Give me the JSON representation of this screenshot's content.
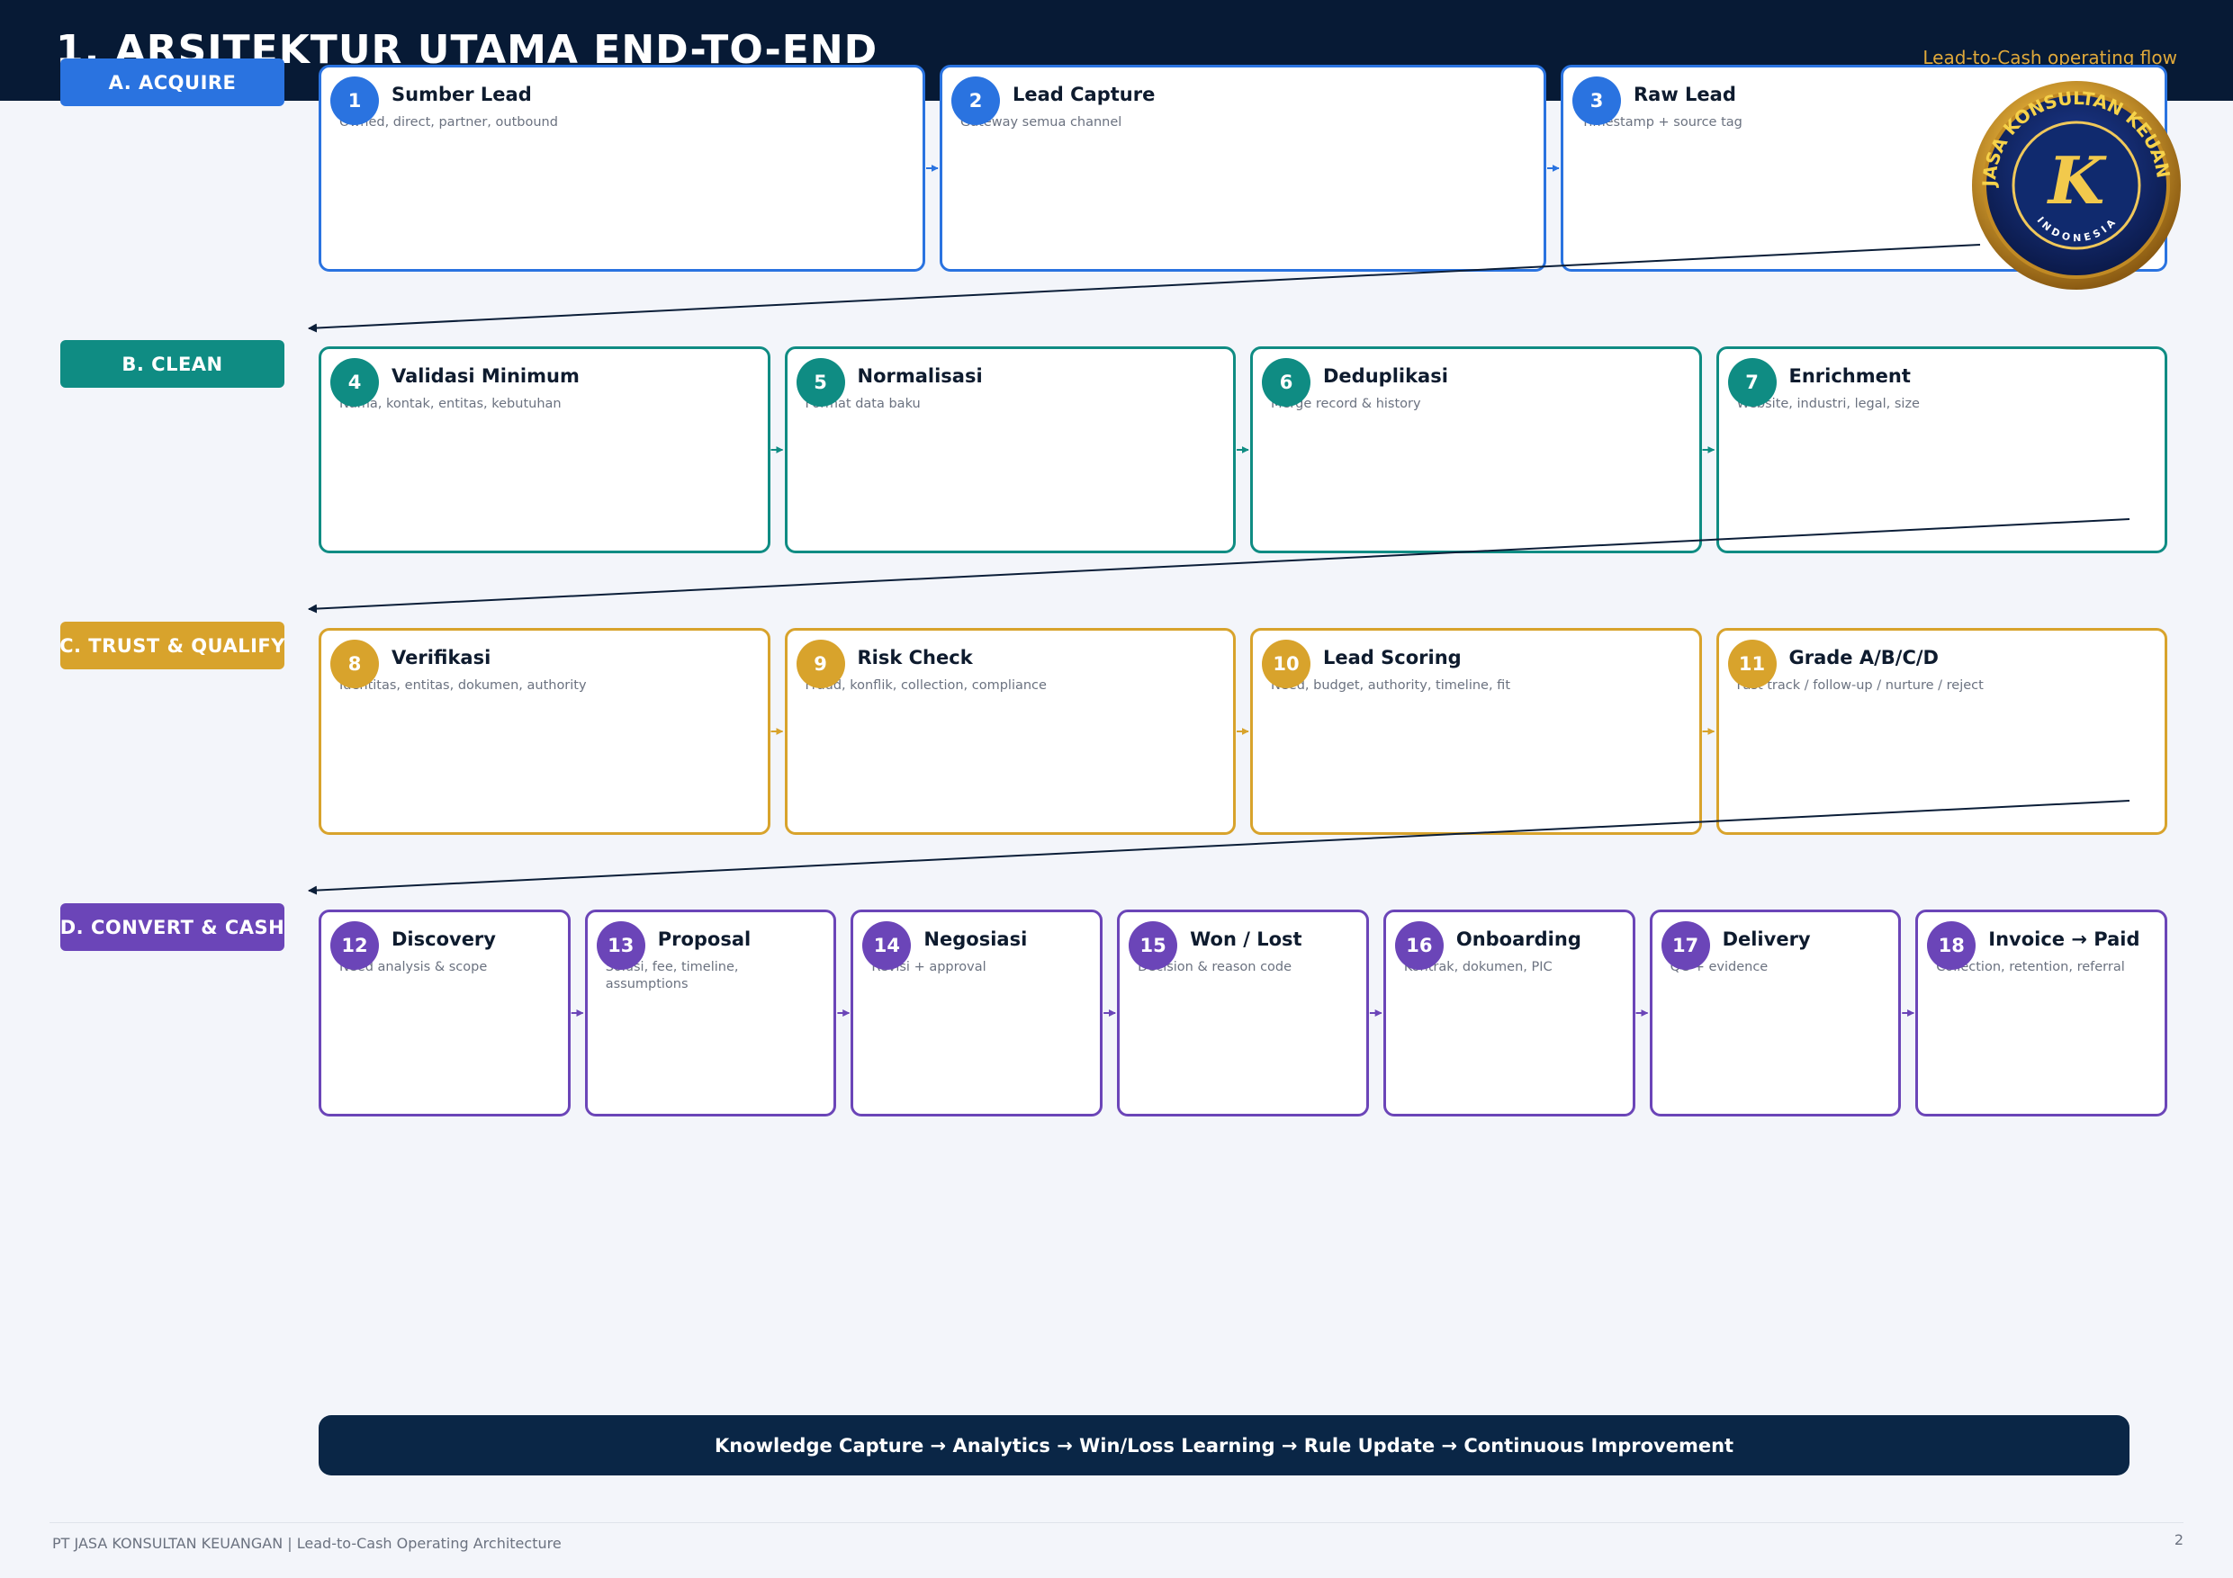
{
  "header": {
    "title": "1. ARSITEKTUR UTAMA END-TO-END",
    "subtitle": "Lead-to-Cash operating flow"
  },
  "colors": {
    "header_bg": "#071a35",
    "acquire": "#2a73e0",
    "clean": "#0f8c83",
    "trust": "#d8a32c",
    "convert": "#6b45b8",
    "banner_bg": "#0a2646",
    "connector": "#0b1e38"
  },
  "lanes": [
    {
      "label": "A. ACQUIRE",
      "color": "#2a73e0",
      "steps": [
        {
          "num": "1",
          "title": "Sumber Lead",
          "desc": "Owned, direct, partner, outbound"
        },
        {
          "num": "2",
          "title": "Lead Capture",
          "desc": "Gateway semua channel"
        },
        {
          "num": "3",
          "title": "Raw Lead",
          "desc": "Timestamp + source tag"
        }
      ]
    },
    {
      "label": "B. CLEAN",
      "color": "#0f8c83",
      "steps": [
        {
          "num": "4",
          "title": "Validasi Minimum",
          "desc": "Nama, kontak, entitas, kebutuhan"
        },
        {
          "num": "5",
          "title": "Normalisasi",
          "desc": "Format data baku"
        },
        {
          "num": "6",
          "title": "Deduplikasi",
          "desc": "Merge record & history"
        },
        {
          "num": "7",
          "title": "Enrichment",
          "desc": "Website, industri, legal, size"
        }
      ]
    },
    {
      "label": "C. TRUST & QUALIFY",
      "color": "#d8a32c",
      "steps": [
        {
          "num": "8",
          "title": "Verifikasi",
          "desc": "Identitas, entitas, dokumen, authority"
        },
        {
          "num": "9",
          "title": "Risk Check",
          "desc": "Fraud, konflik, collection, compliance"
        },
        {
          "num": "10",
          "title": "Lead Scoring",
          "desc": "Need, budget, authority, timeline, fit"
        },
        {
          "num": "11",
          "title": "Grade A/B/C/D",
          "desc": "Fast track / follow-up / nurture / reject"
        }
      ]
    },
    {
      "label": "D. CONVERT & CASH",
      "color": "#6b45b8",
      "steps": [
        {
          "num": "12",
          "title": "Discovery",
          "desc": "Need analysis & scope"
        },
        {
          "num": "13",
          "title": "Proposal",
          "desc": "Solusi, fee, timeline, assumptions"
        },
        {
          "num": "14",
          "title": "Negosiasi",
          "desc": "Revisi + approval"
        },
        {
          "num": "15",
          "title": "Won / Lost",
          "desc": "Decision & reason code"
        },
        {
          "num": "16",
          "title": "Onboarding",
          "desc": "Kontrak, dokumen, PIC"
        },
        {
          "num": "17",
          "title": "Delivery",
          "desc": "QC + evidence"
        },
        {
          "num": "18",
          "title": "Invoice → Paid",
          "desc": "Collection, retention, referral"
        }
      ]
    }
  ],
  "banner": "Knowledge Capture → Analytics → Win/Loss Learning → Rule Update → Continuous Improvement",
  "footer": {
    "left": "PT JASA KONSULTAN KEUANGAN | Lead-to-Cash Operating Architecture",
    "page": "2"
  },
  "seal": {
    "ring_text": "PT. JASA KONSULTAN KEUANGAN",
    "bottom_text": "INDONESIA",
    "monogram": "K"
  }
}
